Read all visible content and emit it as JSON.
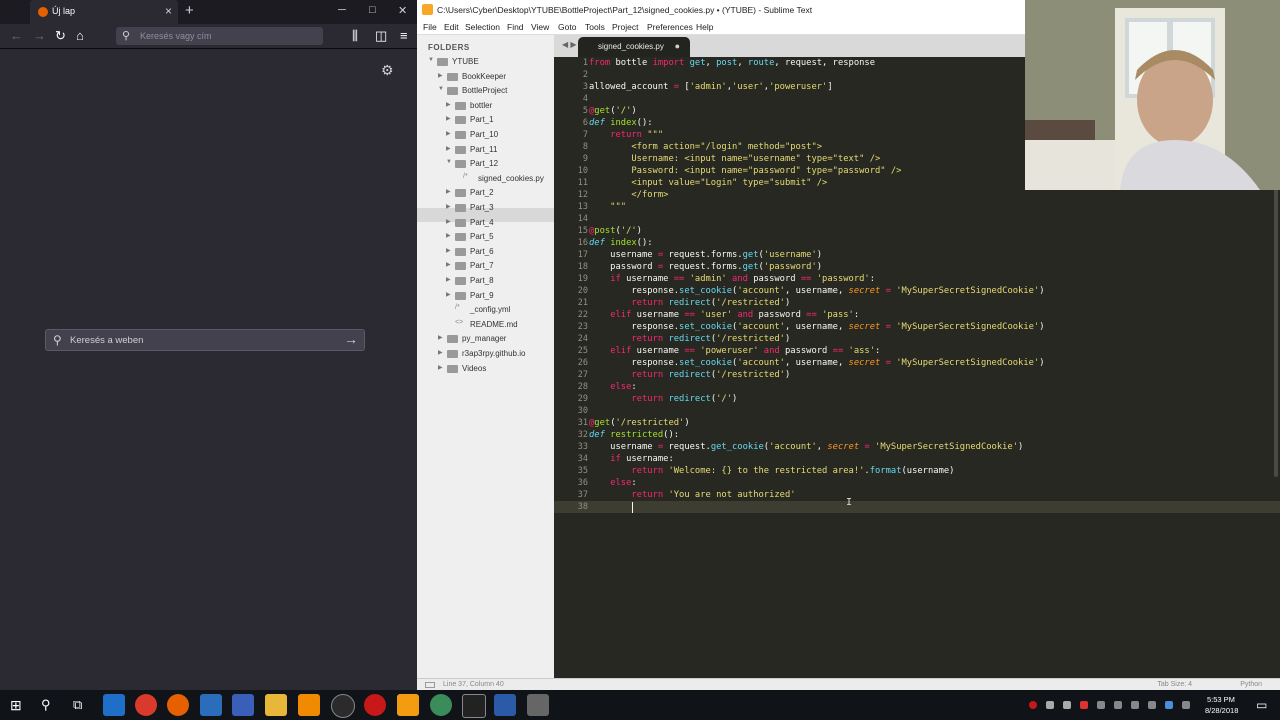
{
  "firefox": {
    "tab_title": "Új lap",
    "url_placeholder": "Keresés vagy cím",
    "search_placeholder": "Keresés a weben"
  },
  "sublime": {
    "title": "C:\\Users\\Cyber\\Desktop\\YTUBE\\BottleProject\\Part_12\\signed_cookies.py • (YTUBE) - Sublime Text",
    "menu": [
      "File",
      "Edit",
      "Selection",
      "Find",
      "View",
      "Goto",
      "Tools",
      "Project",
      "Preferences",
      "Help"
    ],
    "sidebar_header": "FOLDERS",
    "tree": [
      {
        "label": "YTUBE",
        "kind": "folder",
        "expanded": true
      },
      {
        "label": "BookKeeper",
        "kind": "folder",
        "expanded": false
      },
      {
        "label": "BottleProject",
        "kind": "folder",
        "expanded": true
      },
      {
        "label": "bottler",
        "kind": "folder",
        "expanded": false
      },
      {
        "label": "Part_1",
        "kind": "folder",
        "expanded": false
      },
      {
        "label": "Part_10",
        "kind": "folder",
        "expanded": false
      },
      {
        "label": "Part_11",
        "kind": "folder",
        "expanded": false
      },
      {
        "label": "Part_12",
        "kind": "folder",
        "expanded": true
      },
      {
        "label": "signed_cookies.py",
        "kind": "file",
        "selected": true
      },
      {
        "label": "Part_2",
        "kind": "folder",
        "expanded": false
      },
      {
        "label": "Part_3",
        "kind": "folder",
        "expanded": false
      },
      {
        "label": "Part_4",
        "kind": "folder",
        "expanded": false
      },
      {
        "label": "Part_5",
        "kind": "folder",
        "expanded": false
      },
      {
        "label": "Part_6",
        "kind": "folder",
        "expanded": false
      },
      {
        "label": "Part_7",
        "kind": "folder",
        "expanded": false
      },
      {
        "label": "Part_8",
        "kind": "folder",
        "expanded": false
      },
      {
        "label": "Part_9",
        "kind": "folder",
        "expanded": false
      },
      {
        "label": "_config.yml",
        "kind": "file"
      },
      {
        "label": "README.md",
        "kind": "file"
      },
      {
        "label": "py_manager",
        "kind": "folder",
        "expanded": false
      },
      {
        "label": "r3ap3rpy.github.io",
        "kind": "folder",
        "expanded": false
      },
      {
        "label": "Videos",
        "kind": "folder",
        "expanded": false
      }
    ],
    "tab_name": "signed_cookies.py",
    "code": [
      "from bottle import get, post, route, request, response",
      "",
      "allowed_account = ['admin','user','poweruser']",
      "",
      "@get('/')",
      "def index():",
      "    return \"\"\"",
      "        <form action=\"/login\" method=\"post\">",
      "        Username: <input name=\"username\" type=\"text\" />",
      "        Password: <input name=\"password\" type=\"password\" />",
      "        <input value=\"Login\" type=\"submit\" />",
      "        </form>",
      "    \"\"\"",
      "",
      "@post('/')",
      "def index():",
      "    username = request.forms.get('username')",
      "    password = request.forms.get('password')",
      "    if username == 'admin' and password == 'password':",
      "        response.set_cookie('account', username, secret = 'MySuperSecretSignedCookie')",
      "        return redirect('/restricted')",
      "    elif username == 'user' and password == 'pass':",
      "        response.set_cookie('account', username, secret = 'MySuperSecretSignedCookie')",
      "        return redirect('/restricted')",
      "    elif username == 'poweruser' and password == 'ass':",
      "        response.set_cookie('account', username, secret = 'MySuperSecretSignedCookie')",
      "        return redirect('/restricted')",
      "    else:",
      "        return redirect('/')",
      "",
      "@get('/restricted')",
      "def restricted():",
      "    username = request.get_cookie('account', secret = 'MySuperSecretSignedCookie')",
      "    if username:",
      "        return 'Welcome: {} to the restricted area!'.format(username)",
      "    else:",
      "        return 'You are not authorized'",
      "        "
    ],
    "status_left": "Line 37, Column 40",
    "status_tab": "Tab Size: 4",
    "status_syntax": "Python"
  },
  "taskbar": {
    "time": "5:53 PM",
    "date": "8/28/2018"
  },
  "colors": {
    "editor_bg": "#272822",
    "keyword": "#f92672",
    "string": "#e6db74",
    "function": "#a6e22e",
    "builtin": "#66d9ef",
    "param": "#fd971f"
  }
}
